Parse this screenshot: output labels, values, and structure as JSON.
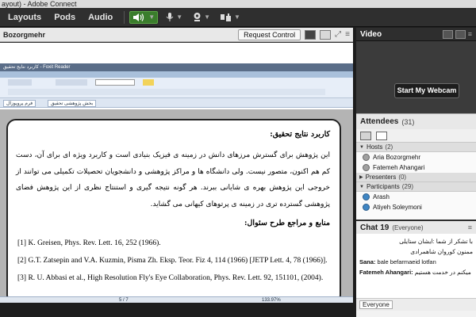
{
  "window": {
    "title": "ayout) - Adobe Connect"
  },
  "menubar": {
    "items": [
      "Layouts",
      "Pods",
      "Audio"
    ],
    "icons": [
      "speaker-icon",
      "microphone-icon",
      "webcam-icon",
      "raise-hand-icon"
    ],
    "active_color": "#3a7d2c"
  },
  "share_pod": {
    "presenter": "Bozorgmehr",
    "stop_label": "Request Control",
    "reader": {
      "strip_title": "کاربرد نتایج تحقیق - Foxit Reader",
      "tabs": [
        "بخش پژوهشی تحقیق",
        "فرم پروپوزال"
      ],
      "zoom": "133.97%",
      "page_indicator": "5 / 7"
    },
    "document": {
      "heading": "کاربرد نتایج تحقیق:",
      "paragraph": "این پژوهش برای گسترش مرزهای دانش در زمینه ی فیزیک بنیادی است و کاربرد ویژه ای برای آن، دست کم هم اکنون، متصور نیست. ولی دانشگاه ها و مراکز پژوهشی و دانشجویان تحصیلات تکمیلی می توانند از خروجی این پژوهش بهره ی شایانی ببرند. هر گونه نتیجه گیری و استنتاج نظری از این پژوهش فضای پژوهشی گسترده تری در زمینه ی پرتوهای کیهانی می گشاید.",
      "refs_heading": "منابع و مراجع طرح سئوال:",
      "refs": [
        "[1] K. Greisen, Phys. Rev. Lett. 16, 252 (1966).",
        "[2] G.T. Zatsepin and V.A. Kuzmin, Pisma Zh. Eksp. Teor. Fiz 4, 114 (1966) [JETP Lett. 4, 78 (1966)].",
        "[3]  R. U. Abbasi et al., High Resolution Fly's Eye Collaboration, Phys. Rev. Lett. 92, 151101, (2004)."
      ]
    }
  },
  "video_pod": {
    "title": "Video",
    "webcam_button": "Start My Webcam"
  },
  "attendees_pod": {
    "title": "Attendees",
    "count": "(31)",
    "groups": [
      {
        "name": "Hosts",
        "count": "(2)",
        "expanded": true,
        "members": [
          "Aria Bozorgmehr",
          "Fatemeh Ahangari"
        ]
      },
      {
        "name": "Presenters",
        "count": "(0)",
        "expanded": false,
        "members": []
      },
      {
        "name": "Participants",
        "count": "(29)",
        "expanded": true,
        "members": [
          "Arash",
          "Atiyeh Soleymoni"
        ]
      }
    ]
  },
  "chat_pod": {
    "title": "Chat",
    "unread": "19",
    "scope": "(Everyone)",
    "messages": [
      {
        "who": "",
        "text": "با تشکر از شما :ایشان ستایلی"
      },
      {
        "who": "",
        "text": "ممنون کوروان شاهمرادی"
      },
      {
        "who": "Sana:",
        "text": " bale befarmaeid lotfan"
      },
      {
        "who": "Fatemeh Ahangari:",
        "text": " خواهش میکنم در خدمت هستیم"
      }
    ],
    "recipient": "Everyone"
  }
}
